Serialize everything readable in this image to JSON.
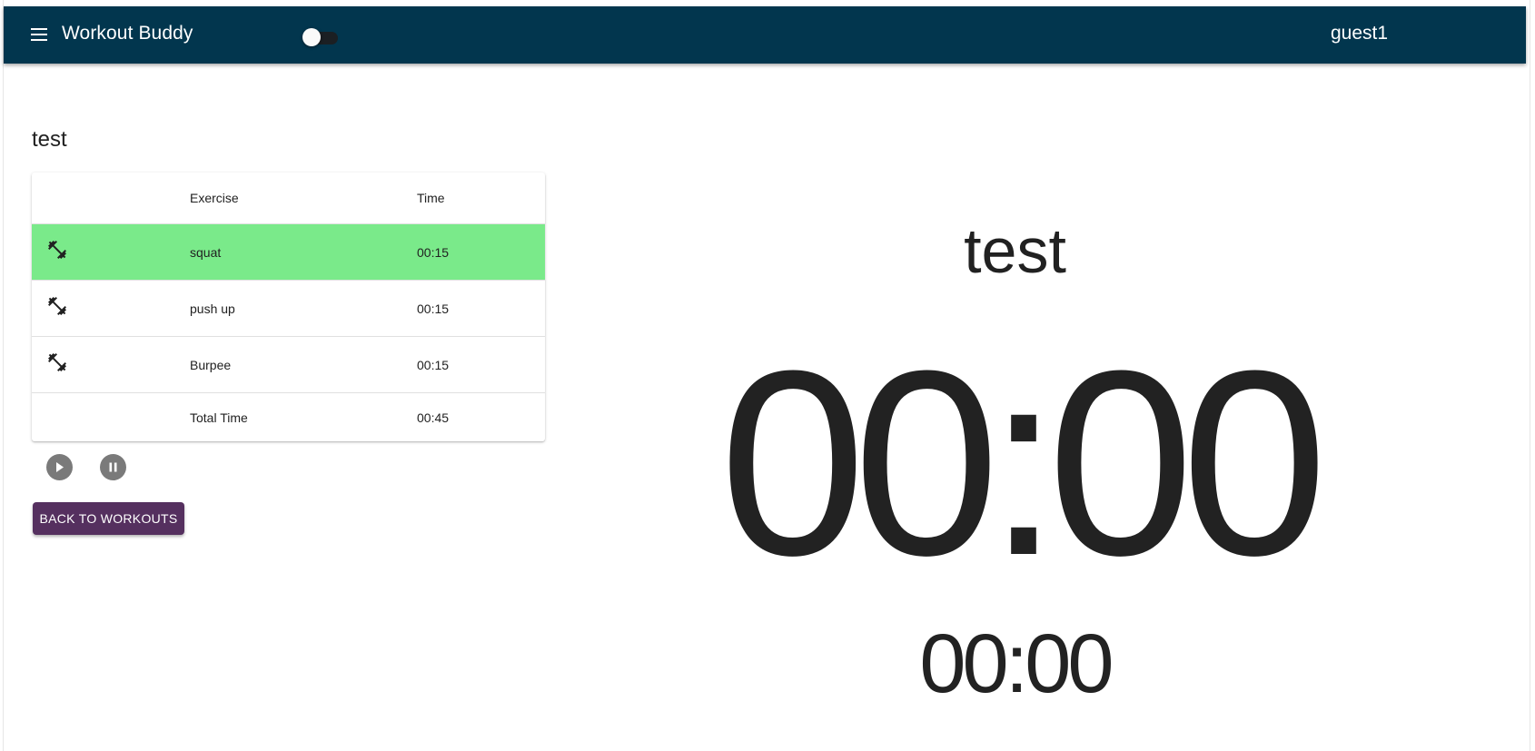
{
  "header": {
    "app_title": "Workout Buddy",
    "menu_icon": "menu-icon",
    "user": "guest1",
    "theme_toggle": "off",
    "bar_color": "#02364e"
  },
  "workout": {
    "title": "test",
    "columns": [
      "",
      "Exercise",
      "Time"
    ],
    "exercises": [
      {
        "icon": "dumbbell-icon",
        "name": "squat",
        "time": "00:15",
        "active": true
      },
      {
        "icon": "dumbbell-icon",
        "name": "push up",
        "time": "00:15",
        "active": false
      },
      {
        "icon": "dumbbell-icon",
        "name": "Burpee",
        "time": "00:15",
        "active": false
      }
    ],
    "total_label": "Total Time",
    "total_time": "00:45",
    "active_row_color": "#7aea8a"
  },
  "controls": {
    "play_icon": "play-icon",
    "pause_icon": "pause-icon",
    "back_label": "BACK TO WORKOUTS",
    "back_color": "#55305f"
  },
  "timer": {
    "title": "test",
    "main": "00:00",
    "sub": "00:00"
  }
}
